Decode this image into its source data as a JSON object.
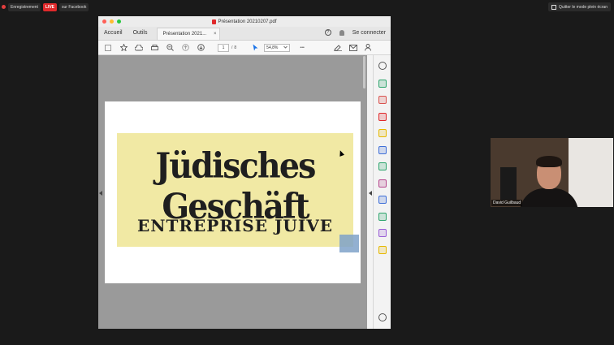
{
  "top_bar": {
    "recording_label": "Enregistrement",
    "live_label": "LIVE",
    "facebook_label": "sur Facebook",
    "exit_fullscreen_label": "Quitter le mode plein écran"
  },
  "window": {
    "title": "Présentation 20210207.pdf"
  },
  "tabs": {
    "home_label": "Accueil",
    "tools_label": "Outils",
    "document_tab_label": "Présentation 2021...",
    "close_symbol": "×",
    "help_symbol": "?",
    "signin_label": "Se connecter"
  },
  "toolbar": {
    "current_page": "1",
    "page_separator": "/",
    "total_pages": "8",
    "zoom_value": "54,8%",
    "more_symbol": "•••"
  },
  "document": {
    "poster_line1": "Jüdisches Geschäft",
    "poster_line2": "ENTREPRISE JUIVE",
    "poster_color": "#f1e9a4"
  },
  "webcam": {
    "participant_name": "David Guilbaud"
  },
  "colors": {
    "live_red": "#e0292b",
    "accent_blue": "#1a73e8"
  },
  "right_panel_icons": [
    {
      "name": "zoom-search-icon",
      "color": "#555555"
    },
    {
      "name": "export-pdf-icon",
      "color": "#2ea56d"
    },
    {
      "name": "organize-pages-icon",
      "color": "#d9534f"
    },
    {
      "name": "create-pdf-icon",
      "color": "#e0292b"
    },
    {
      "name": "comment-icon",
      "color": "#e6b800"
    },
    {
      "name": "send-review-icon",
      "color": "#3f6fd8"
    },
    {
      "name": "edit-pdf-icon",
      "color": "#2ea56d"
    },
    {
      "name": "fill-sign-icon",
      "color": "#b5468d"
    },
    {
      "name": "protect-icon",
      "color": "#3f6fd8"
    },
    {
      "name": "scan-ocr-icon",
      "color": "#2ea56d"
    },
    {
      "name": "request-signature-icon",
      "color": "#9a5ed6"
    },
    {
      "name": "more-tools-icon",
      "color": "#e6b800"
    },
    {
      "name": "customize-tools-icon",
      "color": "#555555"
    }
  ]
}
